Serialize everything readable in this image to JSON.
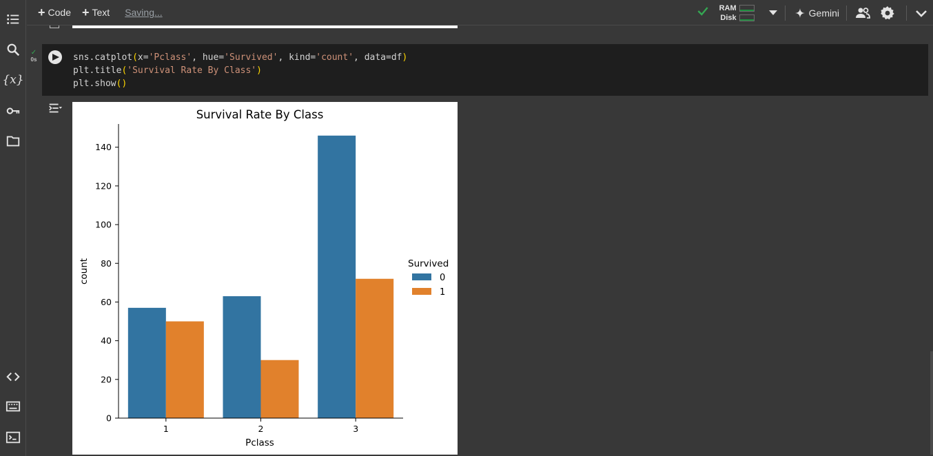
{
  "toolbar": {
    "add_code_label": "Code",
    "add_text_label": "Text",
    "status_text": "Saving...",
    "ram_label": "RAM",
    "disk_label": "Disk",
    "gemini_label": "Gemini"
  },
  "cell": {
    "exec_time": "0s",
    "code": {
      "line1_prefix": "sns.catplot",
      "line1_open": "(",
      "line1_a": "x=",
      "line1_s1": "'Pclass'",
      "line1_b": ", hue=",
      "line1_s2": "'Survived'",
      "line1_c": ", kind=",
      "line1_s3": "'count'",
      "line1_d": ", data=df",
      "line1_close": ")",
      "line2_prefix": "plt.title",
      "line2_open": "(",
      "line2_s": "'Survival Rate By Class'",
      "line2_close": ")",
      "line3_prefix": "plt.show",
      "line3_paren": "()"
    }
  },
  "colors": {
    "series0": "#3274a1",
    "series1": "#e1812c",
    "accent_green": "#34a853"
  },
  "chart_data": {
    "type": "bar",
    "title": "Survival Rate By Class",
    "xlabel": "Pclass",
    "ylabel": "count",
    "categories": [
      "1",
      "2",
      "3"
    ],
    "series": [
      {
        "name": "0",
        "values": [
          57,
          63,
          146
        ]
      },
      {
        "name": "1",
        "values": [
          50,
          30,
          72
        ]
      }
    ],
    "ylim": [
      0,
      152
    ],
    "yticks": [
      0,
      20,
      40,
      60,
      80,
      100,
      120,
      140
    ],
    "legend_title": "Survived",
    "legend_position": "right",
    "grid": false
  }
}
